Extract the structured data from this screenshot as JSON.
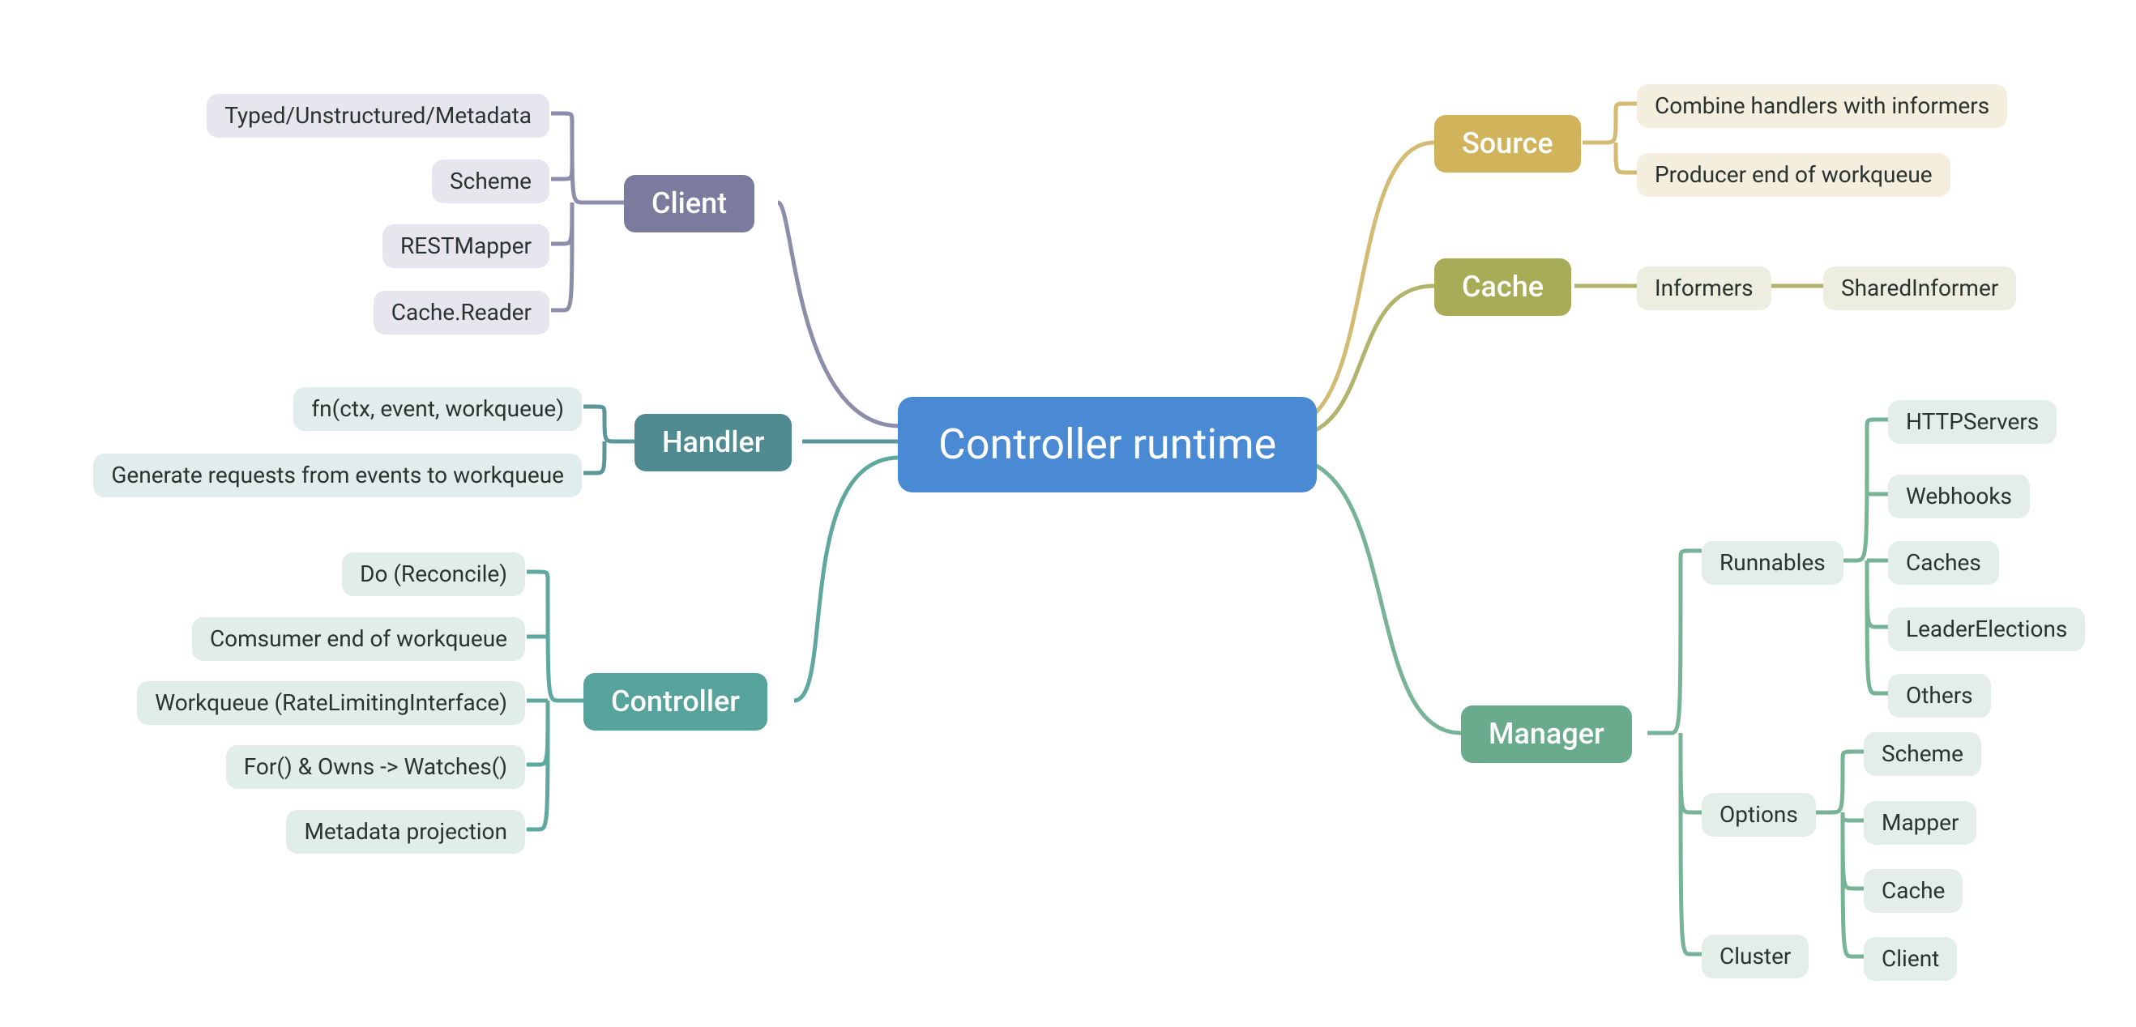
{
  "root": {
    "label": "Controller runtime"
  },
  "branches": {
    "client": {
      "label": "Client",
      "color_node": "#7a7b9d",
      "color_leaf": "#e7e6ee",
      "leaves": [
        "Typed/Unstructured/Metadata",
        "Scheme",
        "RESTMapper",
        "Cache.Reader"
      ]
    },
    "handler": {
      "label": "Handler",
      "color_node": "#4f8b90",
      "color_leaf": "#e1ecec",
      "leaves": [
        "fn(ctx, event, workqueue)",
        "Generate requests from events to workqueue"
      ]
    },
    "controller": {
      "label": "Controller",
      "color_node": "#55a39a",
      "color_leaf": "#e1ede9",
      "leaves": [
        "Do (Reconcile)",
        "Comsumer end of workqueue",
        "Workqueue (RateLimitingInterface)",
        "For() & Owns -> Watches()",
        "Metadata projection"
      ]
    },
    "source": {
      "label": "Source",
      "color_node": "#d0b35a",
      "color_leaf": "#f3eedd",
      "leaves": [
        "Combine handlers with informers",
        "Producer end of workqueue"
      ]
    },
    "cache": {
      "label": "Cache",
      "color_node": "#a9ac56",
      "color_leaf": "#eeeee0",
      "leaves": [
        "Informers"
      ],
      "cache_sub": [
        "SharedInformer"
      ]
    },
    "manager": {
      "label": "Manager",
      "color_node": "#6bab8d",
      "color_leaf": "#e4eee8",
      "leaves": [
        "Runnables",
        "Options",
        "Cluster"
      ],
      "runnables_sub": [
        "HTTPServers",
        "Webhooks",
        "Caches",
        "LeaderElections",
        "Others"
      ],
      "options_sub": [
        "Scheme",
        "Mapper",
        "Cache",
        "Client"
      ]
    }
  }
}
